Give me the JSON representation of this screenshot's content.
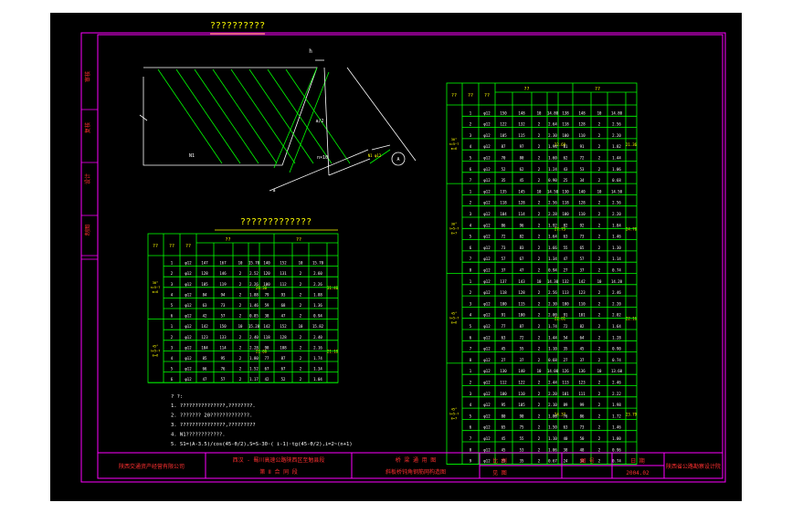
{
  "drawing": {
    "detail_title": "??????????",
    "table_left_title": "?????????????",
    "side_labels": [
      "审核",
      "复核",
      "设计",
      "制图"
    ],
    "notes": [
      "1. ???????????????,????????.",
      "2. ??????? 20?????????????.",
      "3. ???????????????,?????????",
      "4. N1????????????.",
      "5. S1=(A-3.5)/cos(45-θ/2),S=S-30·( i-1)·tg(45-θ/2),i=2~(n+1)"
    ],
    "notes_heading": "? ?:",
    "title_block": {
      "company": "陕西交通资产经营有限公司",
      "project_line1": "西汉 - 蜀川高速公路陕西区至勉县段",
      "project_line2": "第 Ⅱ 合 同 段",
      "drawing_line1": "桥 梁 通 用 图",
      "drawing_line2": "斜板桥钝角钢筋网构造图",
      "scale_label": "比 例",
      "scale_value": "",
      "sheet_label": "图 号",
      "sheet_value": "",
      "date_label": "日 期",
      "date_value": "2004.02",
      "see_label": "见 图",
      "institute": "陕西省公路勘察设计院"
    }
  },
  "left_table": {
    "head_a": "??",
    "head_b": "??",
    "head_c": "??",
    "group1": "??",
    "group2": "??",
    "sub": [
      "S\n(cm)",
      "????\n(cm)",
      "????",
      "??\n(m)",
      "??\n(kg)"
    ],
    "blocks": [
      {
        "label": "30°\nn=5~7\nm=6",
        "total1": "29.38",
        "total2": "31.40",
        "rows": [
          [
            "1",
            "φ12",
            "147",
            "167",
            "10",
            "15.70",
            "140",
            "152",
            "10",
            "15.70"
          ],
          [
            "2",
            "φ12",
            "128",
            "146",
            "2",
            "2.52",
            "120",
            "131",
            "2",
            "2.60"
          ],
          [
            "3",
            "φ12",
            "105",
            "119",
            "2",
            "2.26",
            "100",
            "112",
            "2",
            "2.26"
          ],
          [
            "4",
            "φ12",
            "84",
            "94",
            "2",
            "1.88",
            "79",
            "93",
            "2",
            "1.88"
          ],
          [
            "5",
            "φ12",
            "63",
            "73",
            "2",
            "1.46",
            "59",
            "68",
            "2",
            "1.36"
          ],
          [
            "6",
            "φ12",
            "42",
            "57",
            "2",
            "0.85",
            "38",
            "47",
            "2",
            "0.94"
          ]
        ]
      },
      {
        "label": "45°\nn=5~7\nm=6",
        "total1": "21.00",
        "total2": "21.18",
        "rows": [
          [
            "1",
            "φ12",
            "142",
            "150",
            "10",
            "15.28",
            "142",
            "152",
            "10",
            "15.82"
          ],
          [
            "2",
            "φ12",
            "123",
            "133",
            "2",
            "2.40",
            "118",
            "128",
            "2",
            "2.40"
          ],
          [
            "3",
            "φ12",
            "104",
            "114",
            "2",
            "2.28",
            "98",
            "108",
            "2",
            "2.16"
          ],
          [
            "4",
            "φ12",
            "85",
            "95",
            "2",
            "1.80",
            "77",
            "87",
            "2",
            "1.74"
          ],
          [
            "5",
            "φ12",
            "66",
            "76",
            "2",
            "1.52",
            "67",
            "67",
            "2",
            "1.34"
          ],
          [
            "6",
            "φ12",
            "47",
            "57",
            "2",
            "1.17",
            "42",
            "52",
            "2",
            "1.04"
          ]
        ]
      }
    ]
  },
  "right_table": {
    "head_a": "??",
    "head_b": "??",
    "head_c": "??",
    "group1": "??",
    "group2": "??",
    "sub": [
      "S\n(cm)",
      "????\n(cm)",
      "????",
      "??\n(m)",
      "??\n(kg)"
    ],
    "blocks": [
      {
        "label": "30°\nn=5~7\nm=6",
        "total1": "22.68",
        "total2": "21.36",
        "rows": [
          [
            "1",
            "φ12",
            "150",
            "148",
            "10",
            "14.80",
            "138",
            "148",
            "10",
            "14.80"
          ],
          [
            "2",
            "φ12",
            "122",
            "132",
            "2",
            "2.64",
            "118",
            "128",
            "2",
            "2.56"
          ],
          [
            "3",
            "φ12",
            "105",
            "115",
            "2",
            "2.30",
            "100",
            "110",
            "2",
            "2.20"
          ],
          [
            "4",
            "φ12",
            "87",
            "97",
            "2",
            "1.94",
            "81",
            "91",
            "2",
            "1.82"
          ],
          [
            "5",
            "φ12",
            "70",
            "80",
            "2",
            "1.60",
            "62",
            "72",
            "2",
            "1.44"
          ],
          [
            "6",
            "φ12",
            "52",
            "62",
            "2",
            "1.24",
            "43",
            "53",
            "2",
            "1.06"
          ],
          [
            "7",
            "φ12",
            "35",
            "45",
            "2",
            "0.90",
            "25",
            "34",
            "2",
            "0.68"
          ]
        ]
      },
      {
        "label": "30°\nn=5~7\nm=7",
        "total1": "27.73",
        "total2": "24.70",
        "rows": [
          [
            "1",
            "φ12",
            "135",
            "145",
            "10",
            "14.50",
            "130",
            "140",
            "10",
            "14.50"
          ],
          [
            "2",
            "φ12",
            "118",
            "128",
            "2",
            "2.56",
            "118",
            "128",
            "2",
            "2.56"
          ],
          [
            "3",
            "φ12",
            "104",
            "114",
            "2",
            "2.28",
            "100",
            "110",
            "2",
            "2.20"
          ],
          [
            "4",
            "φ12",
            "86",
            "96",
            "2",
            "1.92",
            "82",
            "92",
            "2",
            "1.84"
          ],
          [
            "5",
            "φ12",
            "72",
            "82",
            "2",
            "1.64",
            "63",
            "73",
            "2",
            "1.46"
          ],
          [
            "6",
            "φ12",
            "73",
            "83",
            "2",
            "1.66",
            "55",
            "65",
            "2",
            "1.30"
          ],
          [
            "7",
            "φ12",
            "57",
            "67",
            "2",
            "1.34",
            "47",
            "57",
            "2",
            "1.14"
          ],
          [
            "8",
            "φ12",
            "37",
            "47",
            "2",
            "0.94",
            "27",
            "37",
            "2",
            "0.74"
          ]
        ]
      },
      {
        "label": "45°\nn=5~7\nm=6",
        "total1": "22.81",
        "total2": "22.16",
        "rows": [
          [
            "1",
            "φ12",
            "137",
            "143",
            "10",
            "14.30",
            "132",
            "142",
            "10",
            "14.20"
          ],
          [
            "2",
            "φ12",
            "118",
            "128",
            "2",
            "2.56",
            "113",
            "123",
            "2",
            "2.46"
          ],
          [
            "3",
            "φ12",
            "100",
            "115",
            "2",
            "2.30",
            "100",
            "110",
            "2",
            "2.20"
          ],
          [
            "4",
            "φ12",
            "91",
            "100",
            "2",
            "2.00",
            "91",
            "101",
            "2",
            "2.02"
          ],
          [
            "5",
            "φ12",
            "77",
            "87",
            "2",
            "1.74",
            "72",
            "82",
            "2",
            "1.64"
          ],
          [
            "6",
            "φ12",
            "63",
            "72",
            "2",
            "1.44",
            "54",
            "64",
            "2",
            "1.28"
          ],
          [
            "7",
            "φ12",
            "45",
            "55",
            "2",
            "1.10",
            "35",
            "45",
            "2",
            "0.90"
          ],
          [
            "8",
            "φ12",
            "27",
            "37",
            "2",
            "0.68",
            "27",
            "37",
            "2",
            "0.74"
          ]
        ]
      },
      {
        "label": "45°\nn=5~7\nm=7",
        "total1": "24.37",
        "total2": "23.79",
        "rows": [
          [
            "1",
            "φ12",
            "130",
            "140",
            "10",
            "14.00",
            "126",
            "136",
            "10",
            "13.60"
          ],
          [
            "2",
            "φ12",
            "112",
            "122",
            "2",
            "2.44",
            "113",
            "123",
            "2",
            "2.46"
          ],
          [
            "3",
            "φ12",
            "100",
            "110",
            "2",
            "2.20",
            "101",
            "111",
            "2",
            "2.22"
          ],
          [
            "4",
            "φ12",
            "95",
            "105",
            "2",
            "2.10",
            "89",
            "99",
            "2",
            "1.98"
          ],
          [
            "5",
            "φ12",
            "80",
            "90",
            "2",
            "1.80",
            "76",
            "86",
            "2",
            "1.72"
          ],
          [
            "6",
            "φ12",
            "65",
            "75",
            "2",
            "1.50",
            "63",
            "73",
            "2",
            "1.46"
          ],
          [
            "7",
            "φ12",
            "45",
            "55",
            "2",
            "1.10",
            "40",
            "50",
            "2",
            "1.00"
          ],
          [
            "8",
            "φ12",
            "45",
            "53",
            "2",
            "1.06",
            "38",
            "48",
            "2",
            "0.96"
          ],
          [
            "9",
            "φ12",
            "25",
            "35",
            "2",
            "0.67",
            "24",
            "34",
            "2",
            "0.74"
          ]
        ]
      }
    ]
  },
  "detail_labels": {
    "top_tag": "h",
    "bar_label": "N1",
    "dim1": "a",
    "dim2": "n×10",
    "dim3": "a/2",
    "bar_note": "N1 φ12\nφ12 30",
    "circle": "A"
  },
  "colors": {
    "background": "#000000",
    "frame": "#ff00ff",
    "line_white": "#ffffff",
    "line_green": "#00ff00",
    "text_yellow": "#ffff00",
    "title_red": "#ff3030"
  }
}
